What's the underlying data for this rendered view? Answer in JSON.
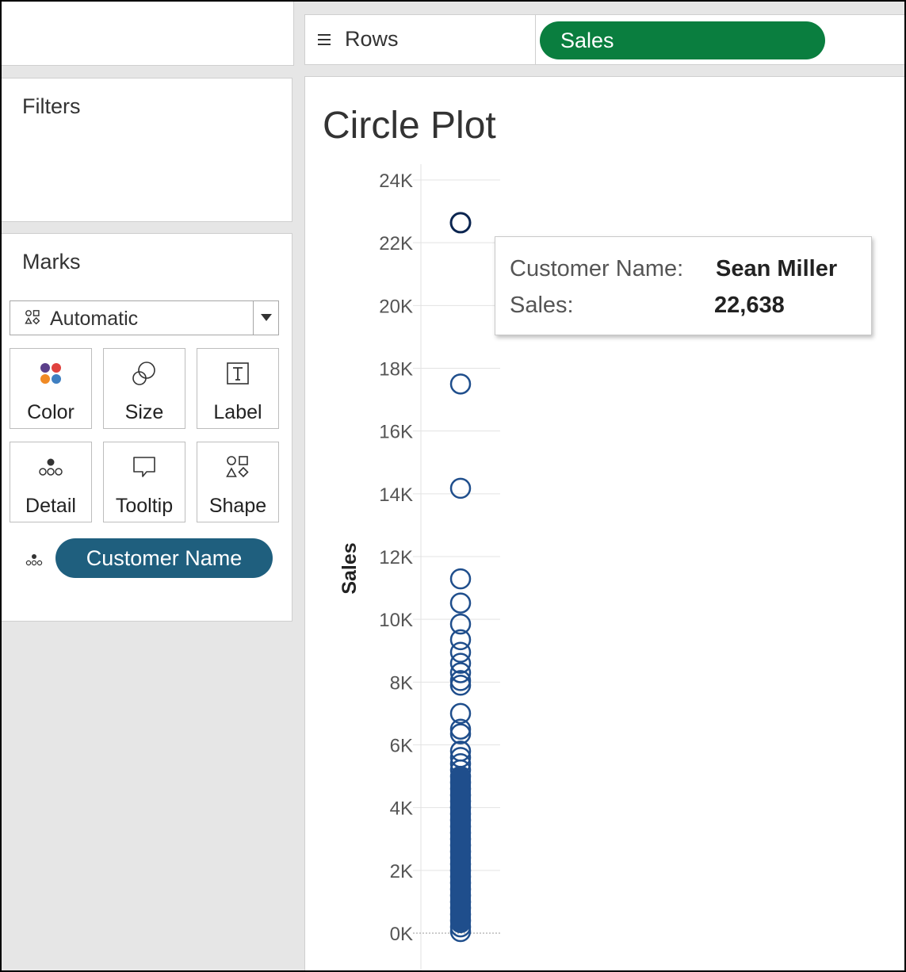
{
  "shelves": {
    "rows_label": "Rows",
    "rows_pill": "Sales"
  },
  "filters": {
    "title": "Filters"
  },
  "marks": {
    "title": "Marks",
    "mark_type": "Automatic",
    "buttons": [
      {
        "label": "Color",
        "icon": "color-dots-icon"
      },
      {
        "label": "Size",
        "icon": "size-icon"
      },
      {
        "label": "Label",
        "icon": "label-text-icon"
      },
      {
        "label": "Detail",
        "icon": "detail-dots-icon"
      },
      {
        "label": "Tooltip",
        "icon": "tooltip-bubble-icon"
      },
      {
        "label": "Shape",
        "icon": "shapes-icon"
      }
    ],
    "detail_pill": "Customer Name"
  },
  "colors": {
    "mark": "#1f4e8c",
    "highlight": "#0b2550",
    "sales_pill": "#0a7e3f",
    "dimension_pill": "#1f5f7e"
  },
  "chart_data": {
    "type": "scatter",
    "title": "Circle Plot",
    "ylabel": "Sales",
    "ylim": [
      0,
      24000
    ],
    "y_ticks": [
      "0K",
      "2K",
      "4K",
      "6K",
      "8K",
      "10K",
      "12K",
      "14K",
      "16K",
      "18K",
      "20K",
      "22K",
      "24K"
    ],
    "grid": true,
    "marker": "open-circle",
    "highlighted_value": 22638,
    "values": [
      22638,
      17499,
      14175,
      11290,
      10520,
      9850,
      9350,
      8950,
      8600,
      8300,
      8050,
      7900,
      7000,
      6500,
      6350,
      5800,
      5600,
      5400,
      5200,
      5000,
      4800,
      4600,
      4400,
      4200,
      4000,
      3800,
      3600,
      3400,
      3200,
      3000,
      2800,
      2600,
      2400,
      2200,
      2000,
      1800,
      1600,
      1400,
      1200,
      1000,
      800,
      600,
      400,
      200,
      50
    ]
  },
  "tooltip": {
    "name_label": "Customer Name:",
    "name_value": "Sean Miller",
    "sales_label": "Sales:",
    "sales_value": "22,638"
  }
}
